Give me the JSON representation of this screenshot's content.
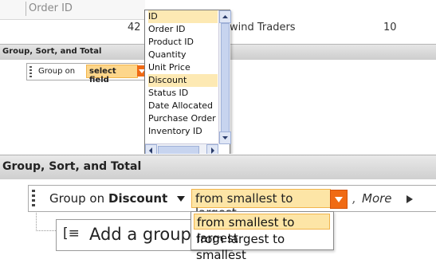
{
  "grid": {
    "header_label": "Order ID",
    "row": {
      "order_id": "42",
      "customer": "wind Traders",
      "quantity": "10"
    }
  },
  "top_panel": {
    "title": "Group, Sort, and Total",
    "group_on_label": "Group on",
    "select_field": "select field"
  },
  "field_list": {
    "items": [
      "ID",
      "Order ID",
      "Product ID",
      "Quantity",
      "Unit Price",
      "Discount",
      "Status ID",
      "Date Allocated",
      "Purchase Order I",
      "Inventory ID"
    ],
    "selected_item": "ID",
    "hover_item": "Discount"
  },
  "bottom_panel": {
    "title": "Group, Sort, and Total",
    "group_on_label": "Group on",
    "group_field": "Discount",
    "sort_value": "from smallest to largest",
    "separator": ",",
    "more_label": "More",
    "add_group_icon": "add-group-icon",
    "add_group_label": "Add a group"
  },
  "sort_menu": {
    "options": [
      "from smallest to largest",
      "from largest to smallest"
    ],
    "selected": "from smallest to largest"
  },
  "colors": {
    "highlight": "#fde5a6",
    "accent_orange": "#f06a14",
    "header_gray": "#d6d6d6"
  }
}
